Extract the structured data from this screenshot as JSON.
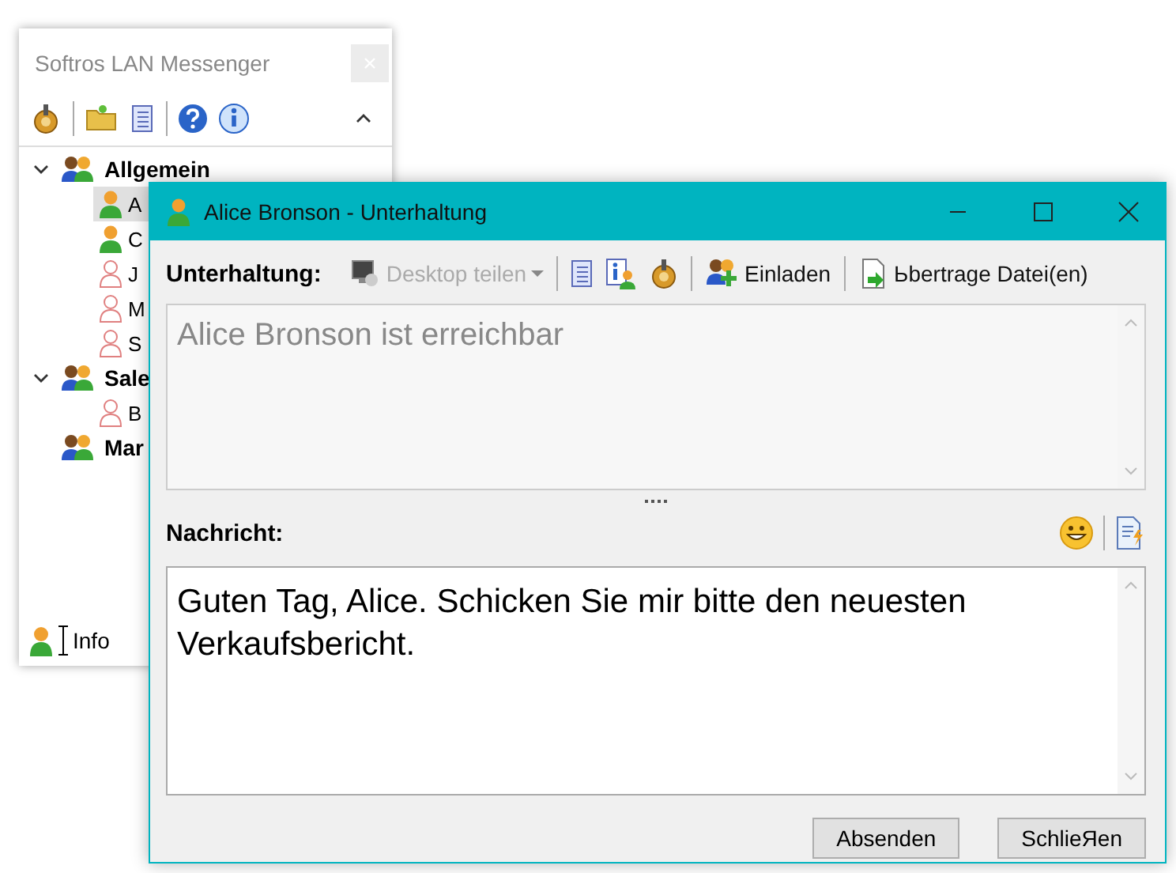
{
  "main_window": {
    "title": "Softros LAN Messenger",
    "groups": [
      {
        "name": "Allgemein",
        "expanded": true,
        "children": [
          {
            "name": "A",
            "online": true,
            "selected": true
          },
          {
            "name": "C",
            "online": true,
            "selected": false
          },
          {
            "name": "J",
            "online": false,
            "selected": false
          },
          {
            "name": "M",
            "online": false,
            "selected": false
          },
          {
            "name": "S",
            "online": false,
            "selected": false
          }
        ]
      },
      {
        "name": "Sale",
        "expanded": true,
        "children": [
          {
            "name": "B",
            "online": false,
            "selected": false
          }
        ]
      },
      {
        "name": "Mar"
      }
    ],
    "status_label": "Info"
  },
  "chat_window": {
    "title": "Alice Bronson - Unterhaltung",
    "conversation_label": "Unterhaltung:",
    "desktop_share": {
      "label": "Desktop teilen",
      "disabled": true
    },
    "invite": {
      "label": "Einladen"
    },
    "transfer": {
      "label": "Ьbertrage Datei(en)"
    },
    "conversation_text": "Alice Bronson ist erreichbar",
    "message_label": "Nachricht:",
    "message_text": "Guten Tag, Alice. Schicken Sie mir bitte den neuesten Verkaufsbericht.",
    "buttons": [
      "Absenden",
      "SchlieЯen"
    ]
  }
}
